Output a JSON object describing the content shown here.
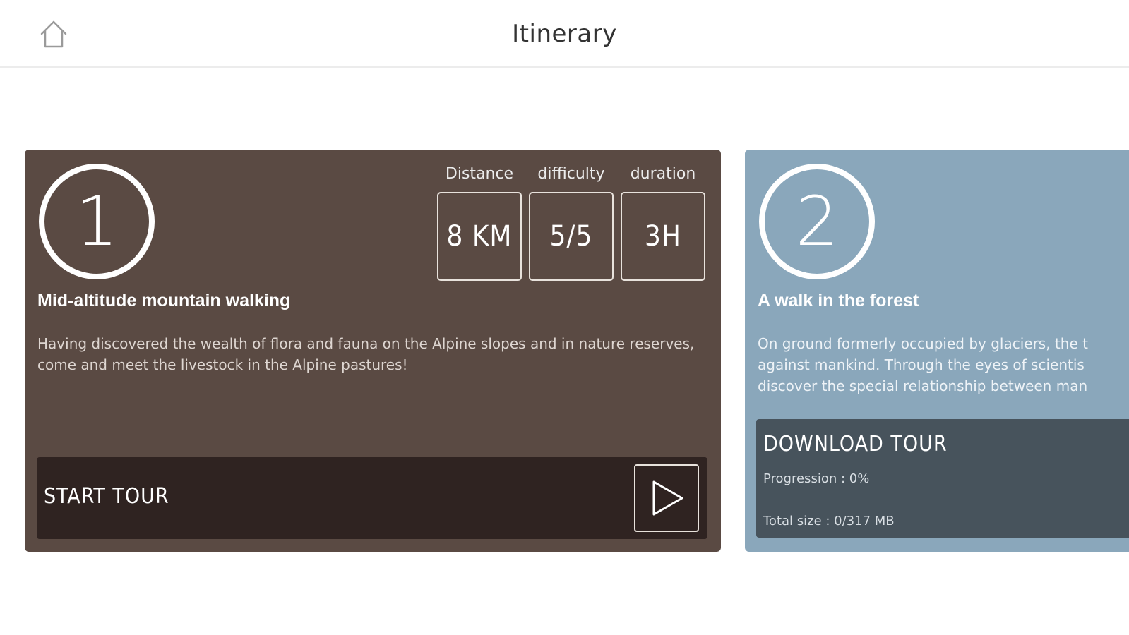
{
  "header": {
    "title": "Itinerary",
    "home_icon": "home-icon"
  },
  "tours": [
    {
      "number": "1",
      "title": "Mid-altitude mountain walking",
      "description": "Having discovered the wealth of flora and fauna on the Alpine slopes and in nature reserves, come and meet the livestock in the Alpine pastures!",
      "stats": {
        "distance_label": "Distance",
        "difficulty_label": "difficulty",
        "duration_label": "duration",
        "distance_value": "8 KM",
        "difficulty_value": "5/5",
        "duration_value": "3H"
      },
      "action_label": "START TOUR",
      "action_icon": "play-icon",
      "background": "#5a4a43",
      "action_background": "#2f2321"
    },
    {
      "number": "2",
      "title": "A walk in the forest",
      "description_lines": [
        "On ground formerly occupied by glaciers, the t",
        "against mankind. Through the eyes of scientis",
        "discover the special relationship between man"
      ],
      "download_label": "DOWNLOAD TOUR",
      "progression_text": "Progression : 0%",
      "progression_percent": 0,
      "size_text": "Total size : 0/317 MB",
      "background": "#8aa7bb",
      "panel_background": "#47535c"
    }
  ]
}
